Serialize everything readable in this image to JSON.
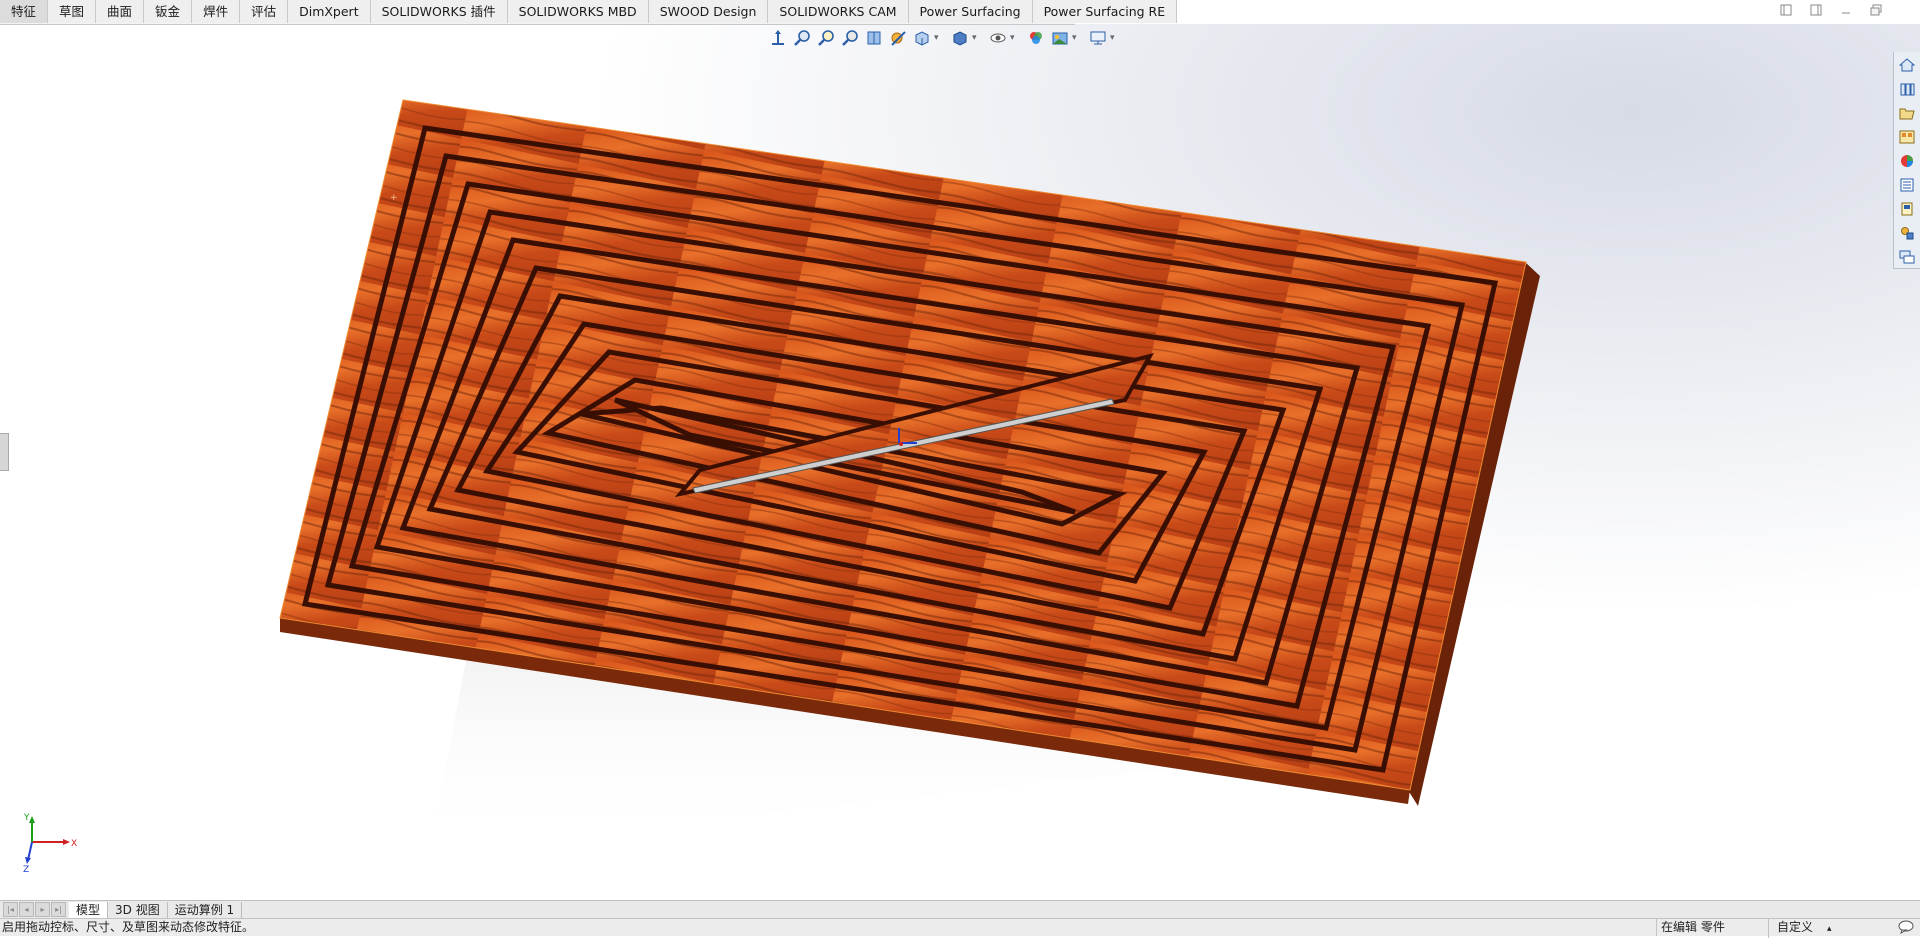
{
  "app": {
    "command_tabs": [
      {
        "label": "特征",
        "active": true
      },
      {
        "label": "草图",
        "active": false
      },
      {
        "label": "曲面",
        "active": false
      },
      {
        "label": "钣金",
        "active": false
      },
      {
        "label": "焊件",
        "active": false
      },
      {
        "label": "评估",
        "active": false
      },
      {
        "label": "DimXpert",
        "active": false
      },
      {
        "label": "SOLIDWORKS 插件",
        "active": false
      },
      {
        "label": "SOLIDWORKS MBD",
        "active": false
      },
      {
        "label": "SWOOD Design",
        "active": false
      },
      {
        "label": "SOLIDWORKS CAM",
        "active": false
      },
      {
        "label": "Power Surfacing",
        "active": false
      },
      {
        "label": "Power Surfacing RE",
        "active": false
      }
    ],
    "window_controls": [
      "restore-left-icon",
      "restore-right-icon",
      "minimize-icon",
      "maximize-icon"
    ]
  },
  "hud_toolbar": [
    "view-orientation-icon",
    "zoom-to-fit-icon",
    "zoom-to-area-icon",
    "previous-view-icon",
    "section-view-icon",
    "dynamic-annotation-icon",
    "view-orientation-cube-icon",
    "display-style-icon",
    "hide-show-items-icon",
    "edit-appearance-icon",
    "apply-scene-icon",
    "view-settings-icon"
  ],
  "task_pane": [
    "solidworks-resources-icon",
    "design-library-icon",
    "file-explorer-icon",
    "view-palette-icon",
    "appearances-scenes-icon",
    "custom-properties-icon",
    "solidworks-forum-icon",
    "3d-content-icon",
    "community-icon"
  ],
  "triad": {
    "x": "X",
    "y": "Y",
    "z": "Z"
  },
  "colors": {
    "wood_light": "#e0621f",
    "wood_mid": "#c4461a",
    "wood_dark": "#5a1a07",
    "axis_x": "#d02020",
    "axis_y": "#1ca01c",
    "axis_z": "#2040d0"
  },
  "model_tabs": [
    {
      "label": "模型",
      "active": true
    },
    {
      "label": "3D 视图",
      "active": false
    },
    {
      "label": "运动算例 1",
      "active": false
    }
  ],
  "status": {
    "message": "启用拖动控标、尺寸、及草图来动态修改特征。",
    "edit_mode": "在编辑 零件",
    "units": "自定义"
  }
}
